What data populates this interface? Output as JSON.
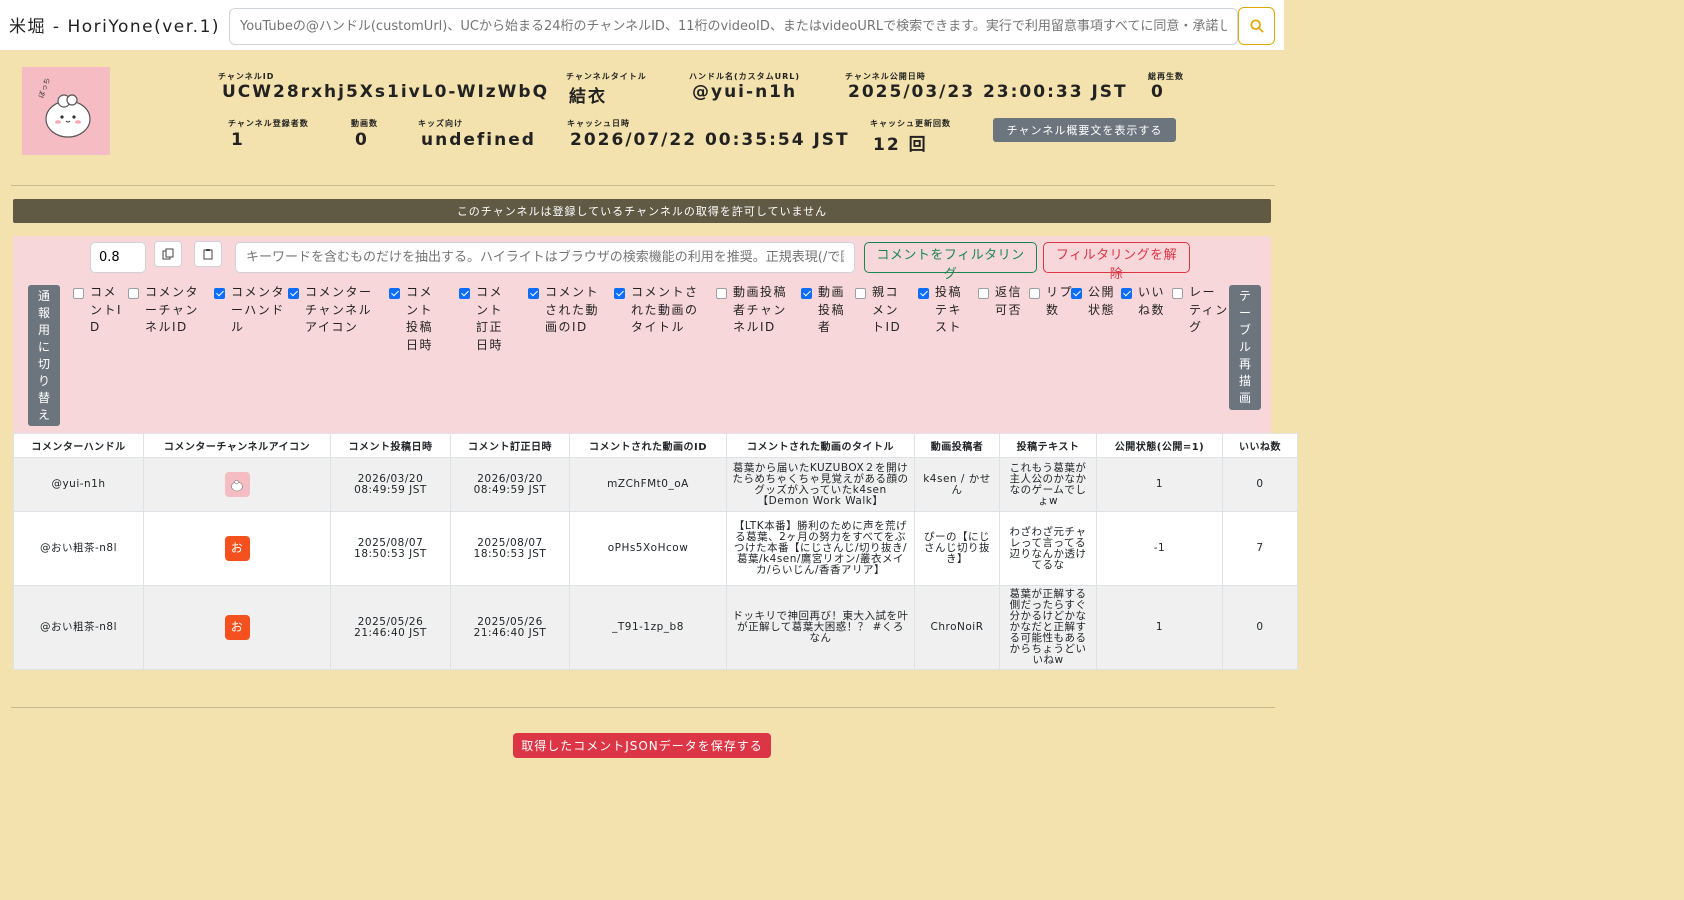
{
  "app": {
    "title": "米堀 - HoriYone(ver.1)",
    "search_placeholder": "YouTubeの@ハンドル(customUrl)、UCから始まる24桁のチャンネルID、11桁のvideoID、またはvideoURLで検索できます。実行で利用留意事項すべてに同意・承諾したとみなします。",
    "search_icon": "search-icon"
  },
  "channel": {
    "id_label": "チャンネルID",
    "id": "UCW28rxhj5Xs1ivL0-WIzWbQ",
    "title_label": "チャンネルタイトル",
    "title": "結衣",
    "handle_label": "ハンドル名(カスタムURL)",
    "handle": "@yui-n1h",
    "published_label": "チャンネル公開日時",
    "published": "2025/03/23 23:00:33 JST",
    "views_label": "総再生数",
    "views": "0",
    "subs_label": "チャンネル登録者数",
    "subs": "1",
    "videos_label": "動画数",
    "videos": "0",
    "kids_label": "キッズ向け",
    "kids": "undefined",
    "cache_label": "キャッシュ日時",
    "cache": "2026/07/22 00:35:54 JST",
    "cache_count_label": "キャッシュ更新回数",
    "cache_count": "12 回",
    "desc_button": "チャンネル概要文を表示する"
  },
  "notice": "このチャンネルは登録しているチャンネルの取得を許可していません",
  "filter": {
    "threshold": "0.8",
    "btn_a_icon": "copy-icon",
    "btn_b_icon": "paste-icon",
    "keyword_placeholder": "キーワードを含むものだけを抽出する。ハイライトはブラウザの検索機能の利用を推奨。正規表現(/で囲む)も使用可能です。",
    "apply_label": "コメントをフィルタリング",
    "clear_label": "フィルタリングを解除",
    "toggle_label": "通報用に切り替え",
    "redraw_label": "テーブル再描画",
    "columns": [
      {
        "label": "コメントID",
        "checked": false
      },
      {
        "label": "コメンターチャンネルID",
        "checked": false
      },
      {
        "label": "コメンターハンドル",
        "checked": true
      },
      {
        "label": "コメンターチャンネルアイコン",
        "checked": true
      },
      {
        "label": "コメント投稿日時",
        "checked": true
      },
      {
        "label": "コメント訂正日時",
        "checked": true
      },
      {
        "label": "コメントされた動画のID",
        "checked": true
      },
      {
        "label": "コメントされた動画のタイトル",
        "checked": true
      },
      {
        "label": "動画投稿者チャンネルID",
        "checked": false
      },
      {
        "label": "動画投稿者",
        "checked": true
      },
      {
        "label": "親コメントID",
        "checked": false
      },
      {
        "label": "投稿テキスト",
        "checked": true
      },
      {
        "label": "返信可否",
        "checked": false
      },
      {
        "label": "リプ数",
        "checked": false
      },
      {
        "label": "公開状態",
        "checked": true
      },
      {
        "label": "いいね数",
        "checked": true
      },
      {
        "label": "レーティング",
        "checked": false
      }
    ]
  },
  "table": {
    "headers": [
      "コメンターハンドル",
      "コメンターチャンネルアイコン",
      "コメント投稿日時",
      "コメント訂正日時",
      "コメントされた動画のID",
      "コメントされた動画のタイトル",
      "動画投稿者",
      "投稿テキスト",
      "公開状態(公開=1)",
      "いいね数"
    ],
    "rows": [
      {
        "handle": "@yui-n1h",
        "icon": {
          "name": "avatar-icon",
          "glyph": "",
          "color": "#f5bcc4"
        },
        "posted": "2026/03/20 08:49:59 JST",
        "edited": "2026/03/20 08:49:59 JST",
        "video_id": "mZChFMt0_oA",
        "video_title": "葛葉から届いたKUZUBOX２を開けたらめちゃくちゃ見覚えがある顔のグッズが入っていたk4sen【Demon Work Walk】",
        "uploader": "k4sen / かせん",
        "text": "これもう葛葉が主人公のかなかなのゲームでしょw",
        "status": "1",
        "likes": "0"
      },
      {
        "handle": "@おい粗茶-n8l",
        "icon": {
          "name": "avatar-icon",
          "glyph": "お",
          "color": "#f4511e"
        },
        "posted": "2025/08/07 18:50:53 JST",
        "edited": "2025/08/07 18:50:53 JST",
        "video_id": "oPHs5XoHcow",
        "video_title": "【LTK本番】勝利のために声を荒げる葛葉、2ヶ月の努力をすべてをぶつけた本番【にじさんじ/切り抜き/葛葉/k4sen/鷹宮リオン/叢衣メイカ/らいじん/香香アリア】",
        "uploader": "ぴーの【にじさんじ切り抜き】",
        "text": "わざわざ元チャレって言ってる辺りなんか透けてるな",
        "status": "-1",
        "likes": "7"
      },
      {
        "handle": "@おい粗茶-n8l",
        "icon": {
          "name": "avatar-icon",
          "glyph": "お",
          "color": "#f4511e"
        },
        "posted": "2025/05/26 21:46:40 JST",
        "edited": "2025/05/26 21:46:40 JST",
        "video_id": "_T91-1zp_b8",
        "video_title": "ドッキリで神回再び！東大入試を叶が正解して葛葉大困惑！？ #くろなん",
        "uploader": "ChroNoiR",
        "text": "葛葉が正解する側だったらすぐ分かるけどかなかなだと正解する可能性もあるからちょうどいいねw",
        "status": "1",
        "likes": "0"
      }
    ]
  },
  "save_button": "取得したコメントJSONデータを保存する"
}
